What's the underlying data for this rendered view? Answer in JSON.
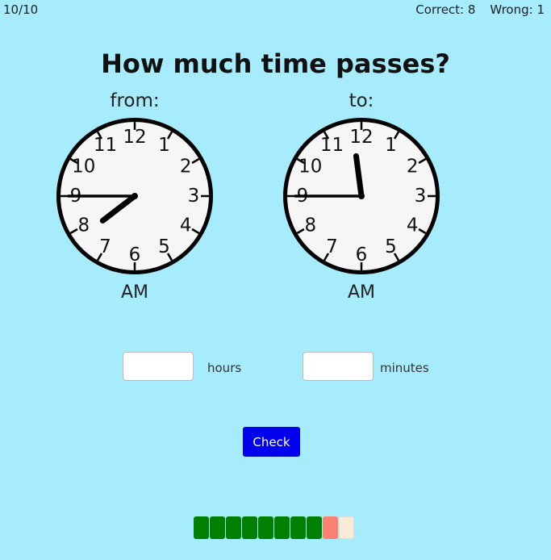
{
  "status": {
    "question_counter": "10/10",
    "correct_label": "Correct: 8",
    "wrong_label": "Wrong: 1"
  },
  "title": "How much time passes?",
  "clocks": [
    {
      "label": "from:",
      "period": "AM",
      "hour": 7,
      "minute": 45
    },
    {
      "label": "to:",
      "period": "AM",
      "hour": 11,
      "minute": 45
    }
  ],
  "clock_numbers": [
    "12",
    "1",
    "2",
    "3",
    "4",
    "5",
    "6",
    "7",
    "8",
    "9",
    "10",
    "11"
  ],
  "inputs": {
    "hours_value": "",
    "hours_label": "hours",
    "minutes_value": "",
    "minutes_label": "minutes"
  },
  "check_label": "Check",
  "progress": [
    "correct",
    "correct",
    "correct",
    "correct",
    "correct",
    "correct",
    "correct",
    "correct",
    "wrong",
    "current"
  ],
  "colors": {
    "background": "#a6ecfc",
    "correct": "#008000",
    "wrong": "#fa8072",
    "current": "#faebd7",
    "button": "#0000ee"
  }
}
